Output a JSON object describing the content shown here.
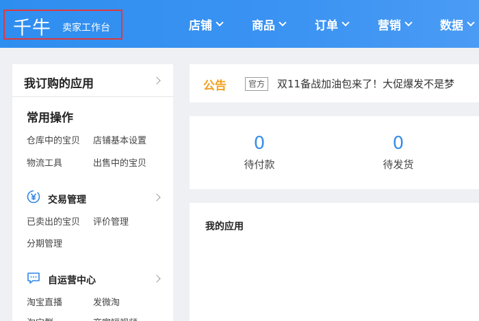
{
  "header": {
    "logo": "千牛",
    "subtitle": "卖家工作台",
    "nav": [
      {
        "label": "店铺"
      },
      {
        "label": "商品"
      },
      {
        "label": "订单"
      },
      {
        "label": "营销"
      },
      {
        "label": "数据"
      }
    ]
  },
  "sidebar": {
    "title": "我订购的应用",
    "common_title": "常用操作",
    "common_links": [
      "仓库中的宝贝",
      "店铺基本设置",
      "物流工具",
      "出售中的宝贝"
    ],
    "groups": [
      {
        "title": "交易管理",
        "icon": "yuan-icon",
        "links": [
          "已卖出的宝贝",
          "评价管理",
          "分期管理"
        ]
      },
      {
        "title": "自运营中心",
        "icon": "chat-icon",
        "links": [
          "淘宝直播",
          "发微淘",
          "淘宝群",
          "商家短视频"
        ]
      }
    ]
  },
  "announcement": {
    "label": "公告",
    "badge": "官方",
    "text": "双11备战加油包来了！大促爆发不是梦"
  },
  "stats": [
    {
      "value": "0",
      "label": "待付款"
    },
    {
      "value": "0",
      "label": "待发货"
    }
  ],
  "myapps": {
    "title": "我的应用"
  },
  "colors": {
    "header_blue": "#3b93f2",
    "stat_blue": "#3a8ee6",
    "announce_orange": "#f0a020",
    "highlight_red": "#e0383b"
  }
}
